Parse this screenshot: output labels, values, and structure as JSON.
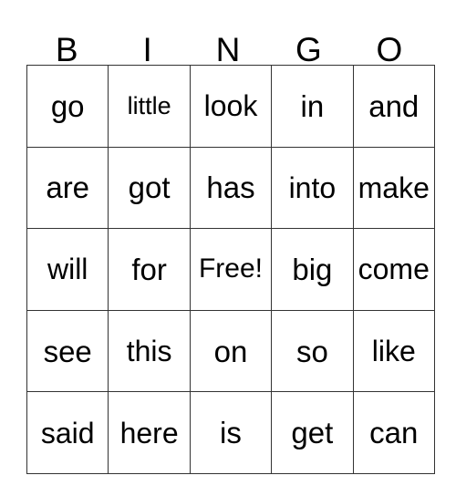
{
  "card": {
    "title_letters": [
      "B",
      "I",
      "N",
      "G",
      "O"
    ],
    "columns": 5,
    "rows": 5,
    "free_space_label": "Free!",
    "free_space_position": {
      "row": 3,
      "column": 3
    },
    "border_color": "#333333",
    "background_color": "#ffffff",
    "text_color": "#000000",
    "grid": [
      [
        "go",
        "little",
        "look",
        "in",
        "and"
      ],
      [
        "are",
        "got",
        "has",
        "into",
        "make"
      ],
      [
        "will",
        "for",
        "Free!",
        "big",
        "come"
      ],
      [
        "see",
        "this",
        "on",
        "so",
        "like"
      ],
      [
        "said",
        "here",
        "is",
        "get",
        "can"
      ]
    ]
  }
}
